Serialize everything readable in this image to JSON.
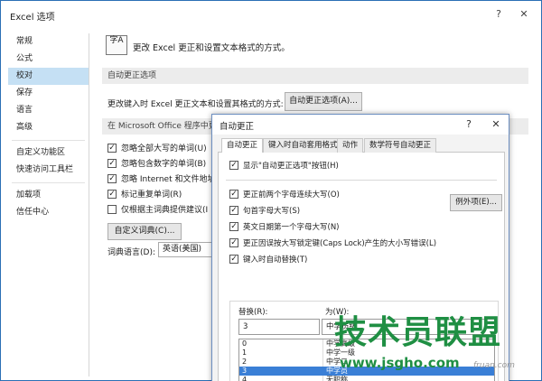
{
  "window": {
    "title": "Excel 选项",
    "help_glyph": "?",
    "close_glyph": "✕"
  },
  "nav": {
    "items": [
      "常规",
      "公式",
      "校对",
      "保存",
      "语言",
      "高级",
      "自定义功能区",
      "快速访问工具栏",
      "加载项",
      "信任中心"
    ],
    "active_index": 2
  },
  "content": {
    "header_icon_text": "字A",
    "header_text": "更改 Excel 更正和设置文本格式的方式。",
    "section1_title": "自动更正选项",
    "autocorrect_row_label": "更改键入时 Excel 更正文本和设置其格式的方式:",
    "autocorrect_button_label": "自动更正选项(A)...",
    "section2_title": "在 Microsoft Office 程序中更",
    "options": [
      {
        "label": "忽略全部大写的单词(U)",
        "checked": true
      },
      {
        "label": "忽略包含数字的单词(B)",
        "checked": true
      },
      {
        "label": "忽略 Internet 和文件地址",
        "checked": true
      },
      {
        "label": "标记重复单词(R)",
        "checked": true
      },
      {
        "label": "仅根据主词典提供建议(I",
        "checked": false
      }
    ],
    "custom_dict_button": "自定义词典(C)...",
    "dict_lang_label": "词典语言(D):",
    "dict_lang_value": "英语(美国)"
  },
  "dialog": {
    "title": "自动更正",
    "help_glyph": "?",
    "close_glyph": "✕",
    "tabs": [
      "自动更正",
      "键入时自动套用格式",
      "动作",
      "数学符号自动更正"
    ],
    "active_tab": 0,
    "show_buttons_option": {
      "label": "显示\"自动更正选项\"按钮(H)",
      "checked": true
    },
    "options": [
      {
        "label": "更正前两个字母连续大写(O)",
        "checked": true
      },
      {
        "label": "句首字母大写(S)",
        "checked": true
      },
      {
        "label": "英文日期第一个字母大写(N)",
        "checked": true
      },
      {
        "label": "更正因误按大写锁定键(Caps Lock)产生的大小写错误(L)",
        "checked": true
      },
      {
        "label": "键入时自动替换(T)",
        "checked": true
      }
    ],
    "exceptions_button": "例外项(E)...",
    "replace_label": "替换(R):",
    "with_label": "为(W):",
    "replace_value": "3",
    "with_value": "中学员级",
    "entries": [
      {
        "key": "0",
        "value": "中学高级"
      },
      {
        "key": "1",
        "value": "中学一级"
      },
      {
        "key": "2",
        "value": "中学二"
      },
      {
        "key": "3",
        "value": "中学员"
      },
      {
        "key": "4",
        "value": "无职称"
      }
    ],
    "selected_entry": 3
  },
  "watermark": {
    "logo_text": "技术员联盟",
    "url": "www.jsgho.com",
    "brand": "fruan.com"
  }
}
